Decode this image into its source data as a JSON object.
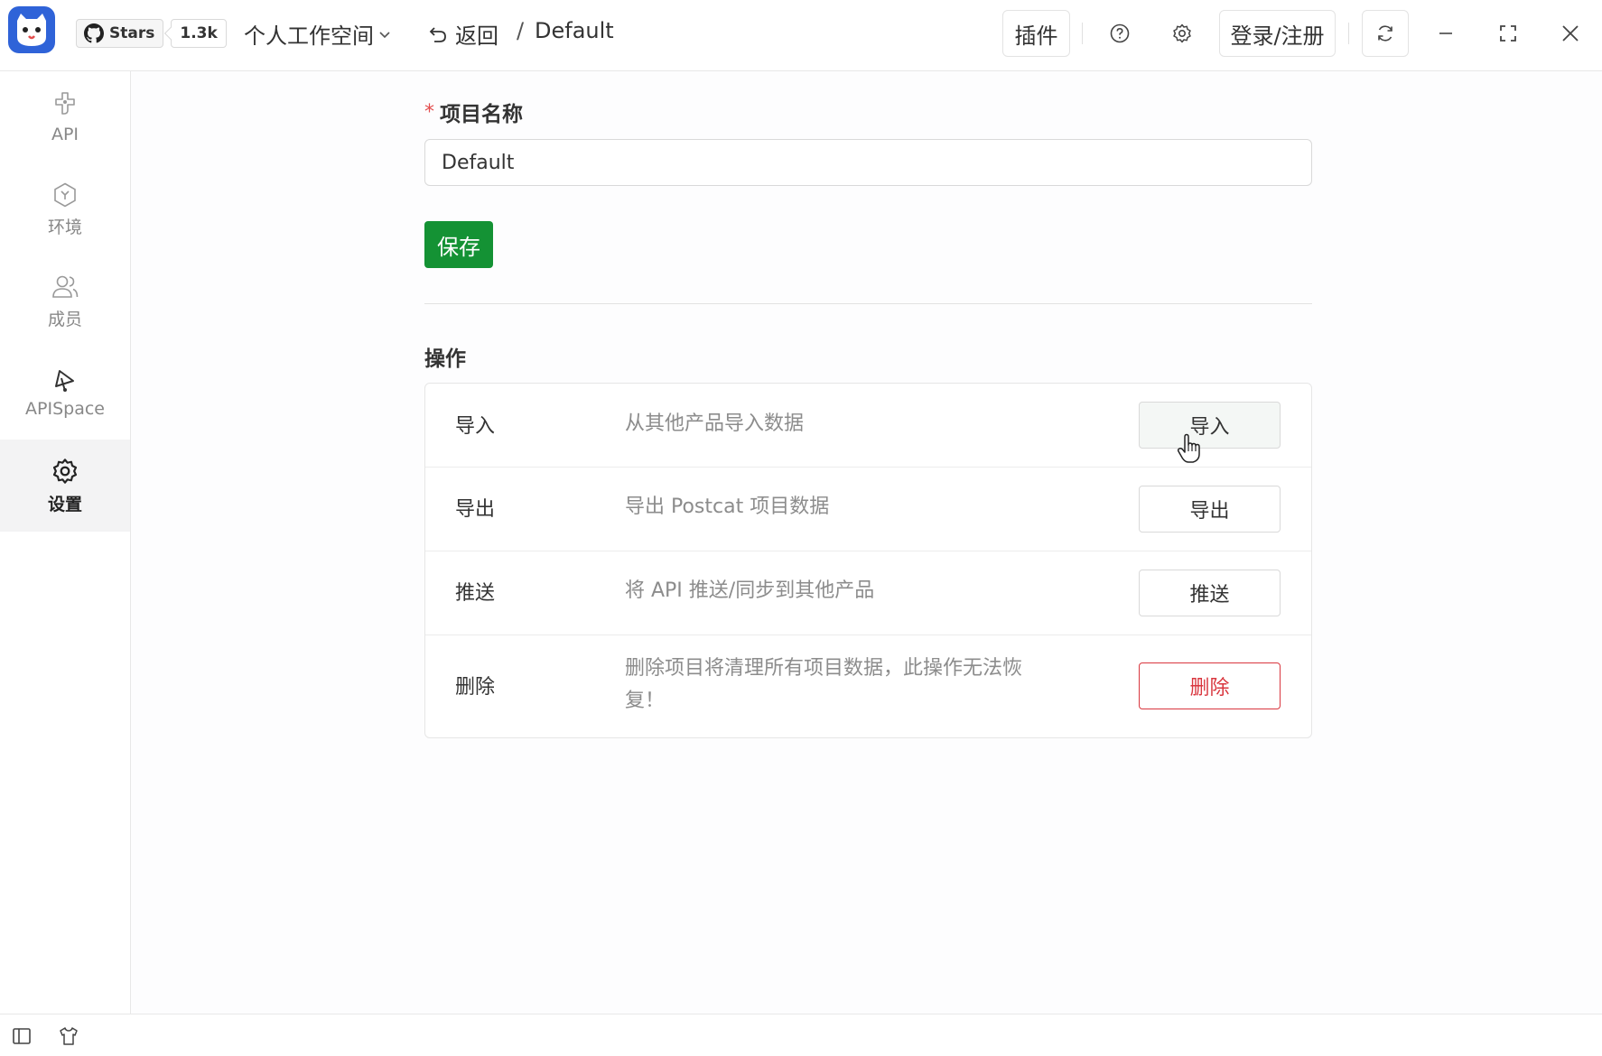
{
  "header": {
    "github_stars_label": "Stars",
    "github_stars_count": "1.3k",
    "workspace_label": "个人工作空间",
    "back_label": "返回",
    "breadcrumb_separator": "/",
    "project_name": "Default",
    "plugins_label": "插件",
    "login_label": "登录/注册"
  },
  "sidebar": {
    "items": [
      {
        "label": "API",
        "icon": "api-icon"
      },
      {
        "label": "环境",
        "icon": "environment-icon"
      },
      {
        "label": "成员",
        "icon": "members-icon"
      },
      {
        "label": "APISpace",
        "icon": "apispace-icon"
      },
      {
        "label": "设置",
        "icon": "settings-icon",
        "active": true
      }
    ]
  },
  "form": {
    "required_mark": "*",
    "name_label": "项目名称",
    "name_value": "Default",
    "save_label": "保存"
  },
  "operations": {
    "title": "操作",
    "rows": [
      {
        "name": "导入",
        "description": "从其他产品导入数据",
        "button": "导入"
      },
      {
        "name": "导出",
        "description": "导出 Postcat 项目数据",
        "button": "导出"
      },
      {
        "name": "推送",
        "description": "将 API 推送/同步到其他产品",
        "button": "推送"
      },
      {
        "name": "删除",
        "description": "删除项目将清理所有项目数据，此操作无法恢复！",
        "button": "删除"
      }
    ]
  },
  "colors": {
    "primary_green": "#149234",
    "danger_red": "#d9363e",
    "logo_blue": "#2f63d8"
  }
}
